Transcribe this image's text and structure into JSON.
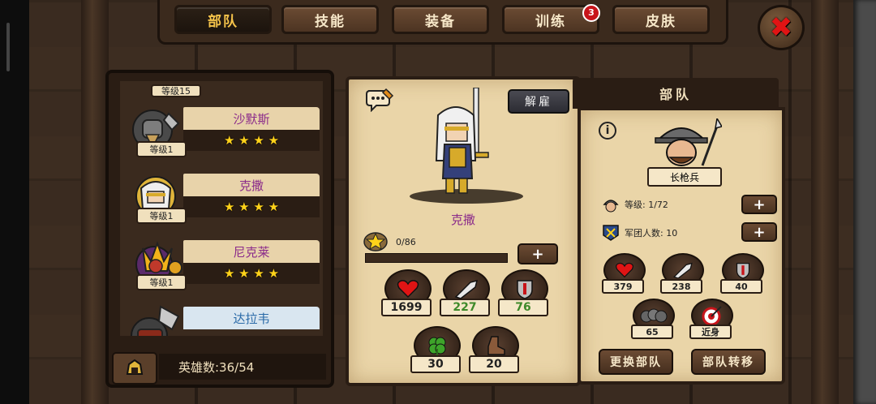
{
  "tabs": [
    {
      "label": "部队",
      "active": true
    },
    {
      "label": "技能",
      "active": false
    },
    {
      "label": "装备",
      "active": false
    },
    {
      "label": "训练",
      "active": false,
      "badge": "3"
    },
    {
      "label": "皮肤",
      "active": false
    }
  ],
  "hero_list": {
    "partial_top_level": "等级15",
    "heroes": [
      {
        "name": "沙默斯",
        "level": "等级1",
        "stars": "★ ★ ★ ★"
      },
      {
        "name": "克撒",
        "level": "等级1",
        "stars": "★ ★ ★ ★"
      },
      {
        "name": "尼克莱",
        "level": "等级1",
        "stars": "★ ★ ★ ★"
      },
      {
        "name": "达拉韦",
        "level": "",
        "stars": ""
      }
    ],
    "hero_count": "英雄数:36/54"
  },
  "selected_hero": {
    "dismiss_label": "解雇",
    "name": "克撒",
    "xp_text": "0/86",
    "xp_progress": 0,
    "plus_label": "+",
    "stats": [
      {
        "icon": "heart-icon",
        "value": "1699",
        "color": "#222222"
      },
      {
        "icon": "sword-icon",
        "value": "227",
        "color": "#3e8a2a"
      },
      {
        "icon": "shield-icon",
        "value": "76",
        "color": "#3e8a2a"
      },
      {
        "icon": "clover-icon",
        "value": "30",
        "color": "#222222"
      },
      {
        "icon": "boot-icon",
        "value": "20",
        "color": "#222222"
      }
    ]
  },
  "troop": {
    "header": "部队",
    "info_label": "i",
    "unit_name": "长枪兵",
    "level_text": "等级: 1/72",
    "legion_text": "军团人数: 10",
    "plus_label": "+",
    "stats": [
      {
        "icon": "heart-icon",
        "value": "379"
      },
      {
        "icon": "sword-icon",
        "value": "238"
      },
      {
        "icon": "shield-icon",
        "value": "40"
      },
      {
        "icon": "soldiers-icon",
        "value": "65"
      },
      {
        "icon": "target-icon",
        "value": "近身"
      }
    ],
    "change_button": "更换部队",
    "transfer_button": "部队转移"
  },
  "colors": {
    "accent_gold": "#f5c34a",
    "hero_name": "#8a2a8a",
    "close_red": "#e01414"
  }
}
